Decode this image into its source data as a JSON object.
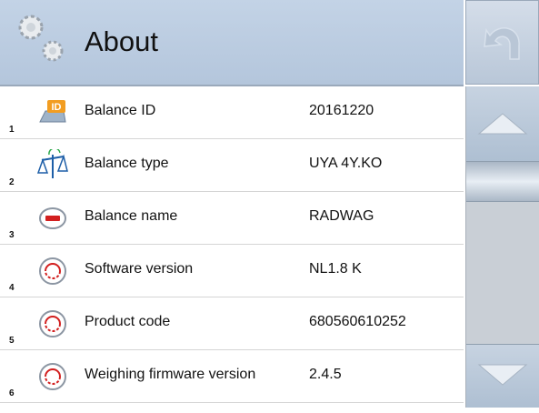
{
  "header": {
    "title": "About",
    "icon": "gears-icon"
  },
  "nav": {
    "back_icon": "undo-arrow-icon",
    "up_icon": "arrow-up-icon",
    "down_icon": "arrow-down-icon"
  },
  "rows": [
    {
      "num": "1",
      "label": "Balance ID",
      "value": "20161220",
      "icon": "balance-id-icon"
    },
    {
      "num": "2",
      "label": "Balance type",
      "value": "UYA 4Y.KO",
      "icon": "scale-icon"
    },
    {
      "num": "3",
      "label": "Balance name",
      "value": "RADWAG",
      "icon": "radwag-logo-icon"
    },
    {
      "num": "4",
      "label": "Software version",
      "value": "NL1.8 K",
      "icon": "rev-icon"
    },
    {
      "num": "5",
      "label": "Product code",
      "value": "680560610252",
      "icon": "rev-icon"
    },
    {
      "num": "6",
      "label": "Weighing firmware version",
      "value": "2.4.5",
      "icon": "rev-icon"
    }
  ],
  "colors": {
    "header": "#b9c9de",
    "accent_orange": "#f29d21",
    "rev_red": "#d21f1f",
    "blue": "#1e5fa8"
  }
}
